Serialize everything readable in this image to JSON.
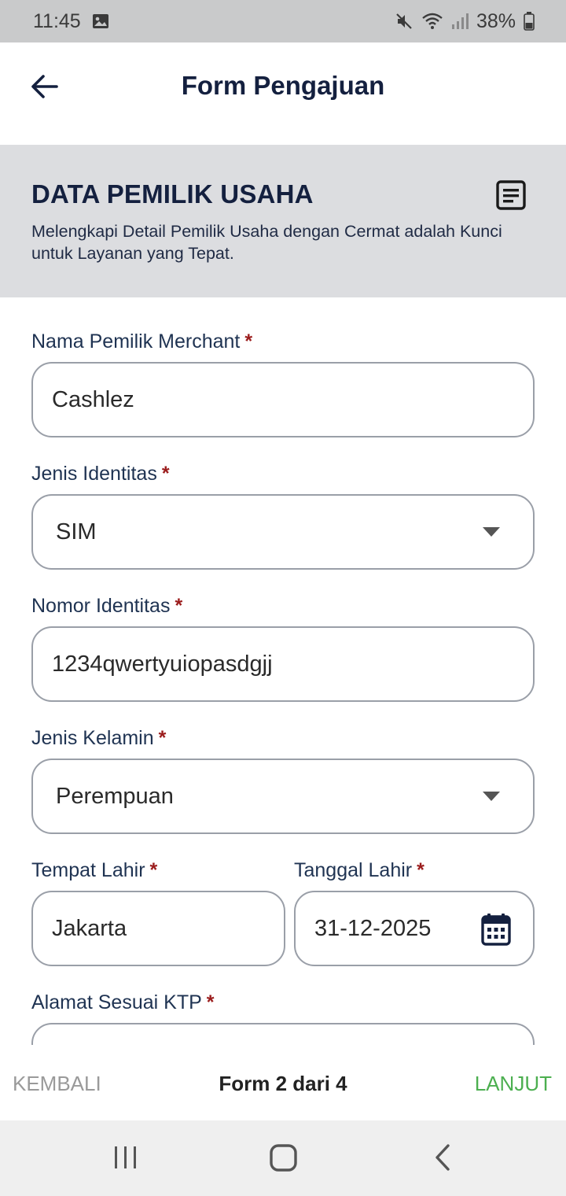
{
  "status_bar": {
    "time": "11:45",
    "battery": "38%",
    "icons": [
      "image-icon",
      "mute-icon",
      "wifi-icon",
      "signal-icon",
      "battery-icon"
    ]
  },
  "app_bar": {
    "title": "Form Pengajuan",
    "back_icon": "arrow-left-icon"
  },
  "section": {
    "title": "DATA PEMILIK USAHA",
    "description": "Melengkapi Detail Pemilik Usaha dengan Cermat adalah Kunci untuk Layanan yang Tepat.",
    "icon": "document-icon"
  },
  "form": {
    "required_mark": "*",
    "owner_name": {
      "label": "Nama Pemilik Merchant",
      "value": "Cashlez"
    },
    "id_type": {
      "label": "Jenis Identitas",
      "value": "SIM"
    },
    "id_number": {
      "label": "Nomor Identitas",
      "value": "1234qwertyuiopasdgjj"
    },
    "gender": {
      "label": "Jenis Kelamin",
      "value": "Perempuan"
    },
    "birth_place": {
      "label": "Tempat Lahir",
      "value": "Jakarta"
    },
    "birth_date": {
      "label": "Tanggal Lahir",
      "value": "31-12-2025",
      "icon": "calendar-icon"
    },
    "address": {
      "label": "Alamat Sesuai KTP",
      "value": ""
    }
  },
  "bottom_bar": {
    "back_label": "KEMBALI",
    "step_text": "Form 2 dari 4",
    "next_label": "LANJUT"
  },
  "colors": {
    "primary_dark": "#14203f",
    "required": "#9b1c1c",
    "next": "#4caf50",
    "header_bg": "#dcdde0"
  },
  "nav_bar": {
    "icons": [
      "recents-icon",
      "home-icon",
      "back-icon"
    ]
  }
}
